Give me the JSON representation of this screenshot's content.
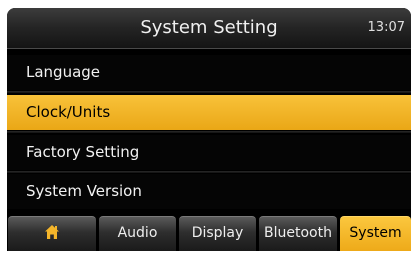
{
  "header": {
    "title": "System Setting",
    "clock": "13:07"
  },
  "menu": {
    "items": [
      {
        "label": "Language",
        "selected": false
      },
      {
        "label": "Clock/Units",
        "selected": true
      },
      {
        "label": "Factory Setting",
        "selected": false
      },
      {
        "label": "System Version",
        "selected": false
      }
    ]
  },
  "tabs": [
    {
      "label": "",
      "icon": "home-icon",
      "active": false
    },
    {
      "label": "Audio",
      "active": false
    },
    {
      "label": "Display",
      "active": false
    },
    {
      "label": "Bluetooth",
      "active": false
    },
    {
      "label": "System",
      "active": true
    }
  ],
  "colors": {
    "accent": "#f2b628",
    "background": "#000000",
    "text": "#f2f2f2"
  }
}
